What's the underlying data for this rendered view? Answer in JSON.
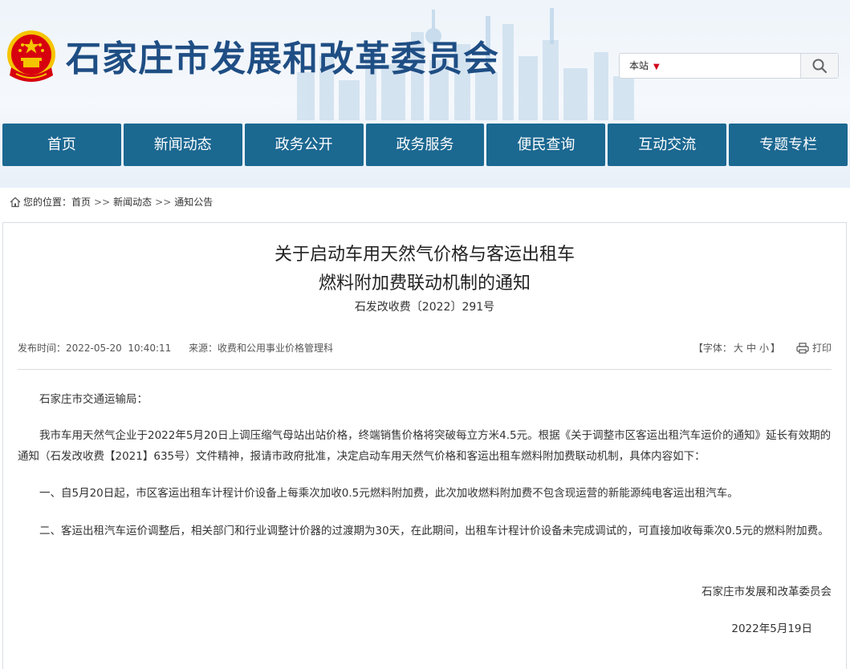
{
  "header": {
    "site_title": "石家庄市发展和改革委员会",
    "search": {
      "scope": "本站",
      "placeholder": ""
    }
  },
  "nav": {
    "items": [
      "首页",
      "新闻动态",
      "政务公开",
      "政务服务",
      "便民查询",
      "互动交流",
      "专题专栏"
    ]
  },
  "breadcrumb": {
    "prefix": "您的位置：",
    "items": [
      "首页",
      "新闻动态",
      "通知公告"
    ],
    "separator": ">>"
  },
  "article": {
    "title_line1": "关于启动车用天然气价格与客运出租车",
    "title_line2": "燃料附加费联动机制的通知",
    "doc_number": "石发改收费〔2022〕291号",
    "publish_label": "发布时间：",
    "publish_time": "2022-05-20  10:40:11",
    "source_label": "来源：",
    "source": "收费和公用事业价格管理科",
    "font_label": "【字体：",
    "font_large": "大",
    "font_medium": "中",
    "font_small": "小",
    "font_close": "】",
    "print_label": "打印",
    "salutation": "石家庄市交通运输局：",
    "para1": "我市车用天然气企业于2022年5月20日上调压缩气母站出站价格，终端销售价格将突破每立方米4.5元。根据《关于调整市区客运出租汽车运价的通知》延长有效期的通知（石发改收费【2021】635号）文件精神，报请市政府批准，决定启动车用天然气价格和客运出租车燃料附加费联动机制，具体内容如下：",
    "para2": "一、自5月20日起，市区客运出租车计程计价设备上每乘次加收0.5元燃料附加费，此次加收燃料附加费不包含现运营的新能源纯电客运出租汽车。",
    "para3": "二、客运出租汽车运价调整后，相关部门和行业调整计价器的过渡期为30天，在此期间，出租车计程计价设备未完成调试的，可直接加收每乘次0.5元的燃料附加费。",
    "signature": "石家庄市发展和改革委员会",
    "date": "2022年5月19日"
  },
  "colors": {
    "nav_bg": "#1b6891",
    "title_blue": "#1f4e84",
    "emblem_red": "#d7000f",
    "emblem_gold": "#f5c400"
  }
}
